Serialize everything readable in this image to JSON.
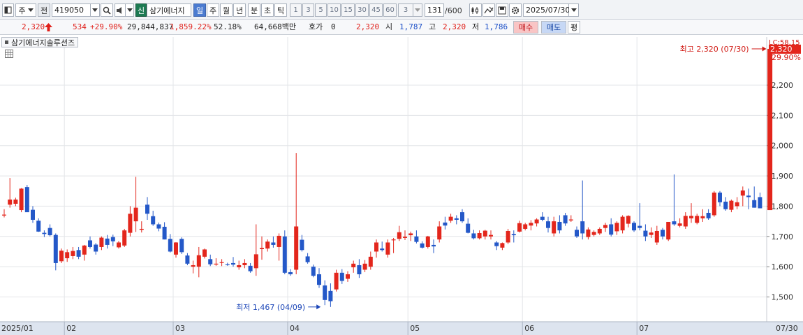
{
  "toolbar": {
    "period_label": "주",
    "prev_label": "전",
    "stock_code": "419050",
    "badge": "신",
    "stock_name": "삼기에너지",
    "periods": [
      "일",
      "주",
      "월",
      "년",
      "분",
      "초",
      "틱"
    ],
    "active_period": "일",
    "intervals": [
      "1",
      "3",
      "5",
      "10",
      "15",
      "30",
      "45",
      "60"
    ],
    "interval_value": "3",
    "count_value": "131",
    "count_max": "/600",
    "date_value": "2025/07/30"
  },
  "quote": {
    "price": "2,320",
    "change": "534",
    "change_pct": "+29.90%",
    "volume": "29,844,837",
    "volume_pct": "1,859.22%",
    "turnover_pct": "52.18%",
    "amount": "64,668백만",
    "hoga_label": "호가",
    "hoga_value": "0",
    "hoga_price": "2,320",
    "open_label": "시",
    "open_value": "1,787",
    "high_label": "고",
    "high_value": "2,320",
    "low_label": "저",
    "low_value": "1,786",
    "buy_label": "매수",
    "sell_label": "매도",
    "flat_label": "평"
  },
  "chart_title": "삼기에너지솔루션즈",
  "colors": {
    "up": "#e3261c",
    "down": "#2458c8",
    "grid": "#e3e5e8",
    "axis_bg": "#dde4ef"
  },
  "chart_data": {
    "type": "candlestick",
    "ylim": [
      1430,
      2340
    ],
    "yticks": [
      1500,
      1600,
      1700,
      1800,
      1900,
      2000,
      2100,
      2200
    ],
    "ytick_labels": [
      "1,500",
      "1,600",
      "1,700",
      "1,800",
      "1,900",
      "2,000",
      "2,100",
      "2,200"
    ],
    "price_label": "2,320",
    "limit_label": "LC:58.15",
    "pct_label": "29.90%",
    "xlabels": [
      "2025/01",
      "02",
      "03",
      "04",
      "05",
      "06",
      "07",
      "07/30"
    ],
    "xlabel_days": [
      0,
      11,
      30,
      50,
      71,
      91,
      111,
      131
    ],
    "annotations": {
      "max": {
        "text": "최고 2,320 (07/30)",
        "value": 2320,
        "day": 131
      },
      "min": {
        "text": "최저 1,467 (04/09)",
        "value": 1467,
        "day": 56
      }
    },
    "candles": [
      {
        "o": 1772,
        "h": 1790,
        "l": 1763,
        "c": 1772
      },
      {
        "o": 1805,
        "h": 1893,
        "l": 1795,
        "c": 1822
      },
      {
        "o": 1808,
        "h": 1828,
        "l": 1800,
        "c": 1822
      },
      {
        "o": 1787,
        "h": 1860,
        "l": 1780,
        "c": 1858
      },
      {
        "o": 1863,
        "h": 1870,
        "l": 1785,
        "c": 1780
      },
      {
        "o": 1788,
        "h": 1800,
        "l": 1745,
        "c": 1755
      },
      {
        "o": 1752,
        "h": 1760,
        "l": 1715,
        "c": 1716
      },
      {
        "o": 1712,
        "h": 1720,
        "l": 1698,
        "c": 1708
      },
      {
        "o": 1728,
        "h": 1740,
        "l": 1700,
        "c": 1704
      },
      {
        "o": 1705,
        "h": 1710,
        "l": 1588,
        "c": 1612
      },
      {
        "o": 1618,
        "h": 1660,
        "l": 1612,
        "c": 1653
      },
      {
        "o": 1628,
        "h": 1657,
        "l": 1616,
        "c": 1648
      },
      {
        "o": 1635,
        "h": 1665,
        "l": 1625,
        "c": 1652
      },
      {
        "o": 1655,
        "h": 1665,
        "l": 1625,
        "c": 1633
      },
      {
        "o": 1640,
        "h": 1672,
        "l": 1620,
        "c": 1670
      },
      {
        "o": 1687,
        "h": 1700,
        "l": 1660,
        "c": 1665
      },
      {
        "o": 1673,
        "h": 1678,
        "l": 1640,
        "c": 1650
      },
      {
        "o": 1665,
        "h": 1700,
        "l": 1655,
        "c": 1696
      },
      {
        "o": 1693,
        "h": 1705,
        "l": 1660,
        "c": 1672
      },
      {
        "o": 1698,
        "h": 1706,
        "l": 1668,
        "c": 1684
      },
      {
        "o": 1664,
        "h": 1685,
        "l": 1660,
        "c": 1680
      },
      {
        "o": 1670,
        "h": 1725,
        "l": 1665,
        "c": 1720
      },
      {
        "o": 1712,
        "h": 1800,
        "l": 1700,
        "c": 1775
      },
      {
        "o": 1750,
        "h": 1897,
        "l": 1715,
        "c": 1795
      },
      {
        "o": 1722,
        "h": 1750,
        "l": 1713,
        "c": 1725
      },
      {
        "o": 1805,
        "h": 1830,
        "l": 1755,
        "c": 1775
      },
      {
        "o": 1767,
        "h": 1785,
        "l": 1735,
        "c": 1740
      },
      {
        "o": 1740,
        "h": 1746,
        "l": 1717,
        "c": 1726
      },
      {
        "o": 1732,
        "h": 1747,
        "l": 1690,
        "c": 1690
      },
      {
        "o": 1692,
        "h": 1708,
        "l": 1647,
        "c": 1650
      },
      {
        "o": 1640,
        "h": 1681,
        "l": 1630,
        "c": 1680
      },
      {
        "o": 1692,
        "h": 1697,
        "l": 1642,
        "c": 1648
      },
      {
        "o": 1637,
        "h": 1645,
        "l": 1605,
        "c": 1610
      },
      {
        "o": 1600,
        "h": 1620,
        "l": 1578,
        "c": 1605
      },
      {
        "o": 1600,
        "h": 1665,
        "l": 1565,
        "c": 1638
      },
      {
        "o": 1633,
        "h": 1660,
        "l": 1627,
        "c": 1657
      },
      {
        "o": 1625,
        "h": 1640,
        "l": 1602,
        "c": 1608
      },
      {
        "o": 1610,
        "h": 1628,
        "l": 1603,
        "c": 1610
      },
      {
        "o": 1614,
        "h": 1625,
        "l": 1602,
        "c": 1615
      },
      {
        "o": 1608,
        "h": 1613,
        "l": 1603,
        "c": 1607
      },
      {
        "o": 1612,
        "h": 1632,
        "l": 1600,
        "c": 1607
      },
      {
        "o": 1598,
        "h": 1620,
        "l": 1590,
        "c": 1605
      },
      {
        "o": 1605,
        "h": 1625,
        "l": 1595,
        "c": 1612
      },
      {
        "o": 1603,
        "h": 1612,
        "l": 1580,
        "c": 1585
      },
      {
        "o": 1595,
        "h": 1740,
        "l": 1570,
        "c": 1641
      },
      {
        "o": 1658,
        "h": 1700,
        "l": 1623,
        "c": 1662
      },
      {
        "o": 1660,
        "h": 1690,
        "l": 1650,
        "c": 1683
      },
      {
        "o": 1680,
        "h": 1700,
        "l": 1663,
        "c": 1672
      },
      {
        "o": 1665,
        "h": 1710,
        "l": 1620,
        "c": 1702
      },
      {
        "o": 1700,
        "h": 1720,
        "l": 1575,
        "c": 1580
      },
      {
        "o": 1582,
        "h": 1592,
        "l": 1570,
        "c": 1575
      },
      {
        "o": 1590,
        "h": 1976,
        "l": 1575,
        "c": 1733
      },
      {
        "o": 1689,
        "h": 1705,
        "l": 1650,
        "c": 1655
      },
      {
        "o": 1634,
        "h": 1645,
        "l": 1610,
        "c": 1615
      },
      {
        "o": 1600,
        "h": 1607,
        "l": 1565,
        "c": 1570
      },
      {
        "o": 1575,
        "h": 1595,
        "l": 1530,
        "c": 1540
      },
      {
        "o": 1538,
        "h": 1555,
        "l": 1473,
        "c": 1490
      },
      {
        "o": 1520,
        "h": 1545,
        "l": 1467,
        "c": 1486
      },
      {
        "o": 1525,
        "h": 1590,
        "l": 1518,
        "c": 1580
      },
      {
        "o": 1580,
        "h": 1592,
        "l": 1543,
        "c": 1553
      },
      {
        "o": 1560,
        "h": 1585,
        "l": 1550,
        "c": 1575
      },
      {
        "o": 1598,
        "h": 1620,
        "l": 1580,
        "c": 1610
      },
      {
        "o": 1605,
        "h": 1625,
        "l": 1563,
        "c": 1575
      },
      {
        "o": 1590,
        "h": 1622,
        "l": 1582,
        "c": 1610
      },
      {
        "o": 1600,
        "h": 1650,
        "l": 1590,
        "c": 1633
      },
      {
        "o": 1650,
        "h": 1690,
        "l": 1630,
        "c": 1680
      },
      {
        "o": 1660,
        "h": 1683,
        "l": 1650,
        "c": 1655
      },
      {
        "o": 1640,
        "h": 1690,
        "l": 1630,
        "c": 1680
      },
      {
        "o": 1690,
        "h": 1695,
        "l": 1645,
        "c": 1690
      },
      {
        "o": 1692,
        "h": 1735,
        "l": 1685,
        "c": 1714
      },
      {
        "o": 1695,
        "h": 1720,
        "l": 1688,
        "c": 1699
      },
      {
        "o": 1704,
        "h": 1716,
        "l": 1685,
        "c": 1710
      },
      {
        "o": 1700,
        "h": 1720,
        "l": 1677,
        "c": 1682
      },
      {
        "o": 1677,
        "h": 1684,
        "l": 1660,
        "c": 1663
      },
      {
        "o": 1665,
        "h": 1702,
        "l": 1660,
        "c": 1700
      },
      {
        "o": 1672,
        "h": 1690,
        "l": 1645,
        "c": 1667
      },
      {
        "o": 1690,
        "h": 1750,
        "l": 1680,
        "c": 1733
      },
      {
        "o": 1746,
        "h": 1765,
        "l": 1723,
        "c": 1736
      },
      {
        "o": 1752,
        "h": 1775,
        "l": 1745,
        "c": 1765
      },
      {
        "o": 1760,
        "h": 1770,
        "l": 1740,
        "c": 1755
      },
      {
        "o": 1780,
        "h": 1790,
        "l": 1745,
        "c": 1750
      },
      {
        "o": 1742,
        "h": 1760,
        "l": 1710,
        "c": 1712
      },
      {
        "o": 1710,
        "h": 1722,
        "l": 1690,
        "c": 1694
      },
      {
        "o": 1694,
        "h": 1720,
        "l": 1690,
        "c": 1711
      },
      {
        "o": 1700,
        "h": 1722,
        "l": 1690,
        "c": 1719
      },
      {
        "o": 1700,
        "h": 1720,
        "l": 1690,
        "c": 1705
      },
      {
        "o": 1680,
        "h": 1685,
        "l": 1655,
        "c": 1668
      },
      {
        "o": 1663,
        "h": 1680,
        "l": 1655,
        "c": 1678
      },
      {
        "o": 1680,
        "h": 1725,
        "l": 1675,
        "c": 1718
      },
      {
        "o": 1708,
        "h": 1720,
        "l": 1680,
        "c": 1704
      },
      {
        "o": 1716,
        "h": 1752,
        "l": 1713,
        "c": 1744
      },
      {
        "o": 1725,
        "h": 1745,
        "l": 1720,
        "c": 1740
      },
      {
        "o": 1736,
        "h": 1754,
        "l": 1720,
        "c": 1745
      },
      {
        "o": 1743,
        "h": 1760,
        "l": 1733,
        "c": 1756
      },
      {
        "o": 1765,
        "h": 1780,
        "l": 1750,
        "c": 1755
      },
      {
        "o": 1750,
        "h": 1765,
        "l": 1713,
        "c": 1728
      },
      {
        "o": 1710,
        "h": 1765,
        "l": 1700,
        "c": 1750
      },
      {
        "o": 1748,
        "h": 1770,
        "l": 1710,
        "c": 1720
      },
      {
        "o": 1770,
        "h": 1778,
        "l": 1735,
        "c": 1743
      },
      {
        "o": 1753,
        "h": 1770,
        "l": 1748,
        "c": 1756
      },
      {
        "o": 1722,
        "h": 1733,
        "l": 1695,
        "c": 1700
      },
      {
        "o": 1750,
        "h": 1885,
        "l": 1690,
        "c": 1710
      },
      {
        "o": 1698,
        "h": 1730,
        "l": 1690,
        "c": 1723
      },
      {
        "o": 1705,
        "h": 1720,
        "l": 1700,
        "c": 1715
      },
      {
        "o": 1710,
        "h": 1730,
        "l": 1705,
        "c": 1725
      },
      {
        "o": 1728,
        "h": 1745,
        "l": 1715,
        "c": 1738
      },
      {
        "o": 1740,
        "h": 1760,
        "l": 1700,
        "c": 1706
      },
      {
        "o": 1717,
        "h": 1750,
        "l": 1705,
        "c": 1745
      },
      {
        "o": 1720,
        "h": 1770,
        "l": 1710,
        "c": 1765
      },
      {
        "o": 1742,
        "h": 1770,
        "l": 1730,
        "c": 1768
      },
      {
        "o": 1745,
        "h": 1750,
        "l": 1715,
        "c": 1720
      },
      {
        "o": 1735,
        "h": 1810,
        "l": 1720,
        "c": 1728
      },
      {
        "o": 1719,
        "h": 1740,
        "l": 1685,
        "c": 1700
      },
      {
        "o": 1705,
        "h": 1730,
        "l": 1695,
        "c": 1713
      },
      {
        "o": 1680,
        "h": 1735,
        "l": 1672,
        "c": 1718
      },
      {
        "o": 1722,
        "h": 1728,
        "l": 1690,
        "c": 1700
      },
      {
        "o": 1690,
        "h": 1745,
        "l": 1685,
        "c": 1748
      },
      {
        "o": 1750,
        "h": 1905,
        "l": 1735,
        "c": 1740
      },
      {
        "o": 1735,
        "h": 1760,
        "l": 1730,
        "c": 1743
      },
      {
        "o": 1733,
        "h": 1780,
        "l": 1725,
        "c": 1768
      },
      {
        "o": 1760,
        "h": 1810,
        "l": 1745,
        "c": 1768
      },
      {
        "o": 1745,
        "h": 1775,
        "l": 1740,
        "c": 1768
      },
      {
        "o": 1760,
        "h": 1790,
        "l": 1748,
        "c": 1767
      },
      {
        "o": 1778,
        "h": 1790,
        "l": 1755,
        "c": 1760
      },
      {
        "o": 1770,
        "h": 1850,
        "l": 1765,
        "c": 1845
      },
      {
        "o": 1845,
        "h": 1850,
        "l": 1800,
        "c": 1813
      },
      {
        "o": 1815,
        "h": 1830,
        "l": 1785,
        "c": 1790
      },
      {
        "o": 1788,
        "h": 1822,
        "l": 1780,
        "c": 1818
      },
      {
        "o": 1800,
        "h": 1830,
        "l": 1790,
        "c": 1813
      },
      {
        "o": 1835,
        "h": 1865,
        "l": 1800,
        "c": 1852
      },
      {
        "o": 1835,
        "h": 1858,
        "l": 1790,
        "c": 1830
      },
      {
        "o": 1820,
        "h": 1865,
        "l": 1795,
        "c": 1795
      },
      {
        "o": 1830,
        "h": 1845,
        "l": 1793,
        "c": 1793
      }
    ]
  }
}
